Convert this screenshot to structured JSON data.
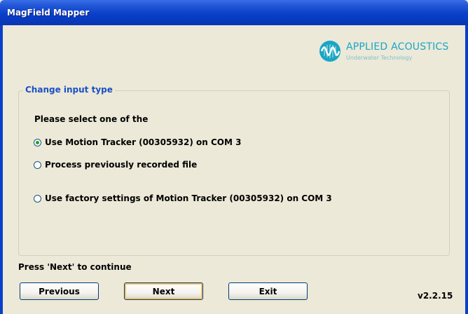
{
  "window": {
    "title": "MagField Mapper"
  },
  "logo": {
    "name": "APPLIED ACOUSTICS",
    "tagline": "Underwater Technology",
    "color": "#1aa6c4"
  },
  "group": {
    "legend": "Change input type",
    "prompt": "Please select one of the",
    "options": [
      {
        "label": "Use Motion Tracker (00305932) on COM 3",
        "selected": true
      },
      {
        "label": "Process previously recorded file",
        "selected": false
      },
      {
        "label": "Use factory settings of Motion Tracker (00305932) on COM 3",
        "selected": false
      }
    ]
  },
  "status": "Press 'Next' to continue",
  "buttons": {
    "previous": "Previous",
    "next": "Next",
    "exit": "Exit"
  },
  "version": "v2.2.15"
}
